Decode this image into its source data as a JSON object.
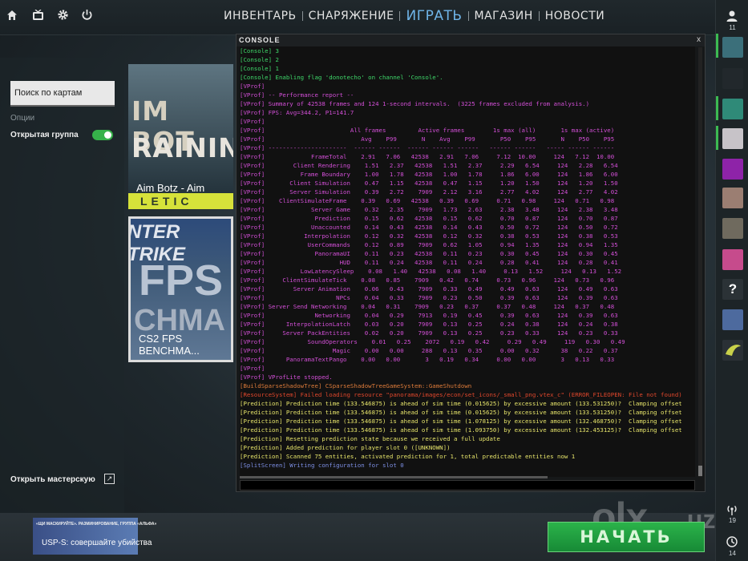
{
  "top_icons": [
    "home-icon",
    "tv-icon",
    "gear-icon",
    "power-icon"
  ],
  "nav": [
    {
      "label": "ИНВЕНТАРЬ",
      "active": false
    },
    {
      "label": "СНАРЯЖЕНИЕ",
      "active": false
    },
    {
      "label": "ИГРАТЬ",
      "active": true
    },
    {
      "label": "МАГАЗИН",
      "active": false
    },
    {
      "label": "НОВОСТИ",
      "active": false
    }
  ],
  "left": {
    "search_placeholder": "Поиск по картам",
    "options_heading": "Опции",
    "open_group_label": "Открытая группа",
    "open_group_on": true,
    "workshop_label": "Открыть мастерскую"
  },
  "maps": [
    {
      "title": "Aim Botz - Aim Traini...",
      "art_line1": "IM BOT",
      "art_line2": "RAININ",
      "strip": "LETIC"
    },
    {
      "title": "CS2 FPS BENCHMA...",
      "art_line1": "NTER TRIKE",
      "art_line2": "FPS",
      "art_line3": "CHMA"
    }
  ],
  "bottom": {
    "mission_small": "«ЩИ МАСКИРУЙТЕ». РАЗМИНИРОВАНИЕ, ГРУППА «АЛЬФА»",
    "mission_text": "USP-S: совершайте убийства",
    "play_label": "НАЧАТЬ"
  },
  "right_sidebar": {
    "friends_count": "11",
    "signal_count": "19",
    "time_count": "14",
    "friend_colors": [
      "#3b6f7a",
      "#22282c",
      "#2f8a78",
      "#c7c3c8",
      "#8e23a8",
      "#9b7e72",
      "#6f6a5e",
      "#c64b8c",
      "#2b3236",
      "#4d6a9e",
      "#c9d14a"
    ]
  },
  "watermark": {
    "brand": "olx",
    "domain": ".uz"
  },
  "console": {
    "title": "CONSOLE",
    "close_label": "x",
    "lines": [
      {
        "c": "c-green",
        "t": "[Console] 3"
      },
      {
        "c": "c-green",
        "t": "[Console] 2"
      },
      {
        "c": "c-green",
        "t": "[Console] 1"
      },
      {
        "c": "c-green",
        "t": "[Console] Enabling flag 'donotecho' on channel 'Console'."
      },
      {
        "c": "c-mag",
        "t": "[VProf]"
      },
      {
        "c": "c-mag",
        "t": "[VProf] -- Performance report --"
      },
      {
        "c": "c-mag",
        "t": "[VProf] Summary of 42538 frames and 124 1-second intervals.  (3225 frames excluded from analysis.)"
      },
      {
        "c": "c-mag",
        "t": "[VProf] FPS: Avg=344.2, P1=141.7"
      },
      {
        "c": "c-mag",
        "t": "[VProf]"
      },
      {
        "c": "c-mag",
        "t": "[VProf]                        All frames         Active frames        1s max (all)       1s max (active)"
      },
      {
        "c": "c-mag",
        "t": "[VProf]                           Avg    P99       N    Avg    P99       P50    P95       N    P50    P95"
      },
      {
        "c": "c-mag",
        "t": "[VProf] ----------------------  ------ ------  ------ ------ ------   ------ ------   ----- ------ ------"
      },
      {
        "c": "c-mag",
        "t": "[VProf]             FrameTotal    2.91   7.06   42538   2.91   7.06     7.12  10.00     124   7.12  10.00"
      },
      {
        "c": "c-mag",
        "t": "[VProf]        Client Rendering    1.51   2.37   42538   1.51   2.37     2.29   6.54     124   2.28   6.54"
      },
      {
        "c": "c-mag",
        "t": "[VProf]          Frame Boundary    1.00   1.78   42538   1.00   1.78     1.86   6.00     124   1.86   6.00"
      },
      {
        "c": "c-mag",
        "t": "[VProf]       Client Simulation    0.47   1.15   42538   0.47   1.15     1.20   1.50     124   1.20   1.50"
      },
      {
        "c": "c-mag",
        "t": "[VProf]       Server Simulation    0.39   2.72    7909   2.12   3.16     2.77   4.02     124   2.77   4.02"
      },
      {
        "c": "c-mag",
        "t": "[VProf]    ClientSimulateFrame    0.39   0.69   42538   0.39   0.69     0.71   0.98     124   0.71   0.98"
      },
      {
        "c": "c-mag",
        "t": "[VProf]             Server Game    0.32   2.35    7909   1.73   2.63     2.38   3.48     124   2.38   3.48"
      },
      {
        "c": "c-mag",
        "t": "[VProf]              Prediction    0.15   0.62   42538   0.15   0.62     0.70   0.87     124   0.70   0.87"
      },
      {
        "c": "c-mag",
        "t": "[VProf]             Unaccounted    0.14   0.43   42538   0.14   0.43     0.50   0.72     124   0.50   0.72"
      },
      {
        "c": "c-mag",
        "t": "[VProf]           Interpolation    0.12   0.32   42538   0.12   0.32     0.38   0.53     124   0.38   0.53"
      },
      {
        "c": "c-mag",
        "t": "[VProf]            UserCommands    0.12   0.89    7909   0.62   1.05     0.94   1.35     124   0.94   1.35"
      },
      {
        "c": "c-mag",
        "t": "[VProf]              PanoramaUI    0.11   0.23   42538   0.11   0.23     0.30   0.45     124   0.30   0.45"
      },
      {
        "c": "c-mag",
        "t": "[VProf]                     HUD    0.11   0.24   42538   0.11   0.24     0.28   0.41     124   0.28   0.41"
      },
      {
        "c": "c-mag",
        "t": "[VProf]          LowLatencySleep    0.08   1.40   42538   0.08   1.40     0.13   1.52     124   0.13   1.52"
      },
      {
        "c": "c-mag",
        "t": "[VProf]     ClientSimulateTick    0.08   0.85    7909   0.42   0.74     0.73   0.96     124   0.73   0.96"
      },
      {
        "c": "c-mag",
        "t": "[VProf]        Server Animation    0.06   0.43    7909   0.33   0.49     0.49   0.63     124   0.49   0.63"
      },
      {
        "c": "c-mag",
        "t": "[VProf]                    NPCs    0.04   0.33    7909   0.23   0.50     0.39   0.63     124   0.39   0.63"
      },
      {
        "c": "c-mag",
        "t": "[VProf] Server Send Networking    0.04   0.31    7909   0.23   0.37     0.37   0.48     124   0.37   0.48"
      },
      {
        "c": "c-mag",
        "t": "[VProf]              Networking    0.04   0.29    7913   0.19   0.45     0.39   0.63     124   0.39   0.63"
      },
      {
        "c": "c-mag",
        "t": "[VProf]      InterpolationLatch    0.03   0.20    7909   0.13   0.25     0.24   0.38     124   0.24   0.38"
      },
      {
        "c": "c-mag",
        "t": "[VProf]     Server PackEntities    0.02   0.20    7909   0.13   0.25     0.23   0.33     124   0.23   0.33"
      },
      {
        "c": "c-mag",
        "t": "[VProf]            SoundOperators    0.01   0.25    2072   0.19   0.42     0.29   0.49     119   0.30   0.49"
      },
      {
        "c": "c-mag",
        "t": "[VProf]                   Magic    0.00   0.00     288   0.13   0.35     0.00   0.32      38   0.22   0.37"
      },
      {
        "c": "c-mag",
        "t": "[VProf]      PanoramaTextPango    0.00   0.00       3   0.19   0.34     0.00   0.00       3   0.13   0.33"
      },
      {
        "c": "c-mag",
        "t": "[VProf]"
      },
      {
        "c": "c-mag",
        "t": "[VProf] VProfLite stopped."
      },
      {
        "c": "c-orange",
        "t": "[BuildSparseShadowTree] CSparseShadowTreeGameSystem::GameShutdown"
      },
      {
        "c": "c-red",
        "t": "[ResourceSystem] Failed loading resource \"panorama/images/econ/set_icons/_small_png.vtex_c\" (ERROR_FILEOPEN: File not found)"
      },
      {
        "c": "c-yellow",
        "t": "[Prediction] Prediction time (133.546875) is ahead of sim time (0.015625) by excessive amount (133.531250)?  Clamping offset"
      },
      {
        "c": "c-yellow",
        "t": "[Prediction] Prediction time (133.546875) is ahead of sim time (0.015625) by excessive amount (133.531250)?  Clamping offset"
      },
      {
        "c": "c-yellow",
        "t": "[Prediction] Prediction time (133.546875) is ahead of sim time (1.078125) by excessive amount (132.468750)?  Clamping offset"
      },
      {
        "c": "c-yellow",
        "t": "[Prediction] Prediction time (133.546875) is ahead of sim time (1.093750) by excessive amount (132.453125)?  Clamping offset"
      },
      {
        "c": "c-yellow",
        "t": "[Prediction] Resetting prediction state because we received a full update"
      },
      {
        "c": "c-yellow",
        "t": "[Prediction] Added prediction for player slot 0 ([UNKNOWN])"
      },
      {
        "c": "c-yellow",
        "t": "[Prediction] Scanned 75 entities, activated prediction for 1, total predictable entities now 1"
      },
      {
        "c": "c-blue",
        "t": "[SplitScreen] Writing configuration for slot 0"
      }
    ]
  }
}
